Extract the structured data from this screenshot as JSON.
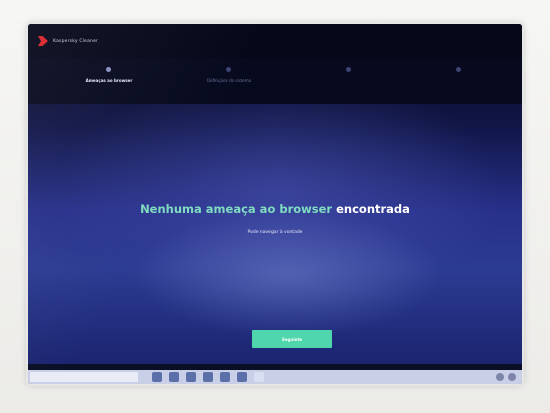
{
  "app": {
    "brand_name": "Kaspersky Cleaner",
    "header_links": [
      "",
      ""
    ]
  },
  "stepper": {
    "steps": [
      {
        "label": "Ameaças ao browser"
      },
      {
        "label": "Definições do sistema"
      },
      {
        "label": ""
      },
      {
        "label": ""
      }
    ],
    "active_index": 0
  },
  "main": {
    "headline_part1": "Nenhuma ameaça ao browser",
    "headline_part2": "encontrada",
    "subtext": "Pode navegar à vontade",
    "primary_button_label": "Seguinte"
  },
  "taskbar": {
    "search_placeholder": ""
  },
  "colors": {
    "accent_green": "#4fd6ad",
    "headline_green": "#7fdcc0",
    "brand_red": "#d8242b",
    "header_dark": "#06081a"
  },
  "icons": {
    "brand": "kaspersky-logo-icon",
    "taskbar": [
      "task-view-icon",
      "edge-browser-icon",
      "file-explorer-icon",
      "store-icon",
      "mail-icon",
      "app-icon",
      "app-icon"
    ]
  }
}
